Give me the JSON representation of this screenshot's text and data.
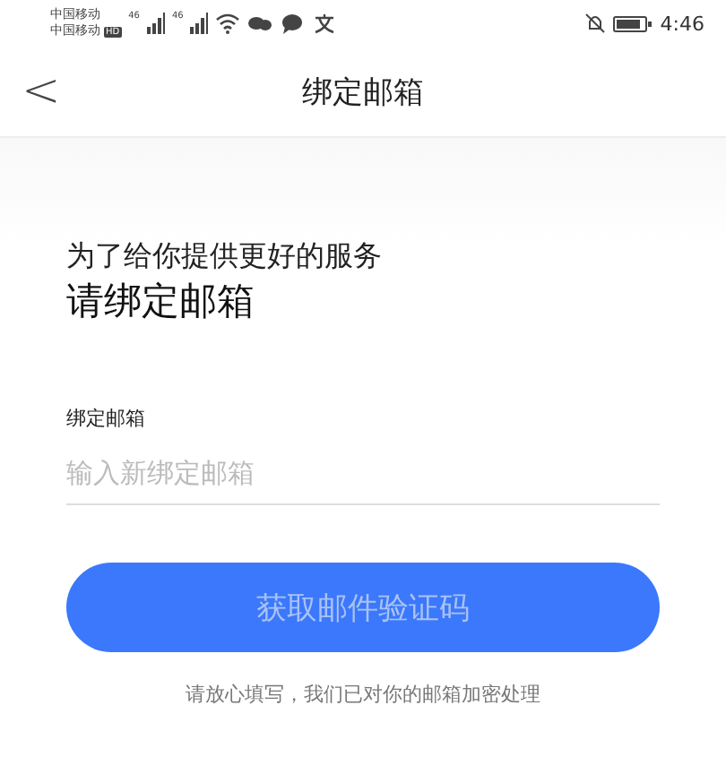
{
  "status_bar": {
    "carriers": [
      "中国移动",
      "中国移动"
    ],
    "hd_badge": "HD",
    "networks": [
      "46",
      "46"
    ],
    "time": "4:46"
  },
  "nav": {
    "back": "<",
    "title": "绑定邮箱"
  },
  "intro": {
    "subtitle": "为了给你提供更好的服务",
    "heading": "请绑定邮箱"
  },
  "field": {
    "label": "绑定邮箱",
    "placeholder": "输入新绑定邮箱"
  },
  "button": {
    "label": "获取邮件验证码",
    "disabled": true
  },
  "note": "请放心填写，我们已对你的邮箱加密处理"
}
